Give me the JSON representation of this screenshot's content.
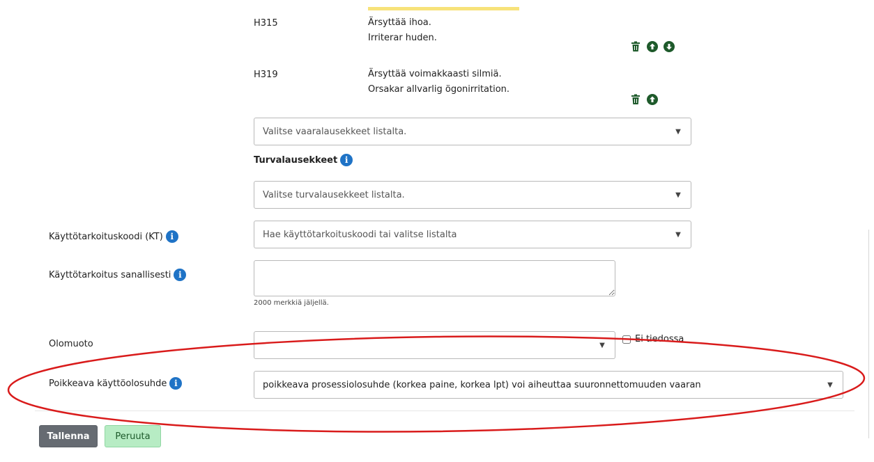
{
  "hazards": [
    {
      "code": "H315",
      "fi": "Ärsyttää ihoa.",
      "sv": "Irriterar huden."
    },
    {
      "code": "H319",
      "fi": "Ärsyttää voimakkaasti silmiä.",
      "sv": "Orsakar allvarlig ögonirritation."
    }
  ],
  "hazard_select": {
    "placeholder": "Valitse vaaralausekkeet listalta."
  },
  "safety": {
    "title": "Turvalausekkeet",
    "placeholder": "Valitse turvalausekkeet listalta."
  },
  "use_code": {
    "label": "Käyttötarkoituskoodi (KT)",
    "placeholder": "Hae käyttötarkoituskoodi tai valitse listalta"
  },
  "use_text": {
    "label": "Käyttötarkoitus sanallisesti",
    "remaining": "2000 merkkiä jäljellä."
  },
  "form_state": {
    "label": "Olomuoto",
    "unknown_label": "Ei tiedossa"
  },
  "exception": {
    "label": "Poikkeava käyttöolosuhde",
    "value": "poikkeava prosessiolosuhde (korkea paine, korkea lpt) voi aiheuttaa suuronnettomuuden vaaran"
  },
  "buttons": {
    "save": "Tallenna",
    "cancel": "Peruuta"
  },
  "icons": {
    "trash": "trash-icon",
    "up": "arrow-up-circle-icon",
    "down": "arrow-down-circle-icon",
    "info": "info-icon"
  },
  "colors": {
    "info": "#1f73c6",
    "action_icon": "#1e5a2b",
    "highlight": "#d91b1b",
    "accent_bar": "#f7e27a"
  }
}
